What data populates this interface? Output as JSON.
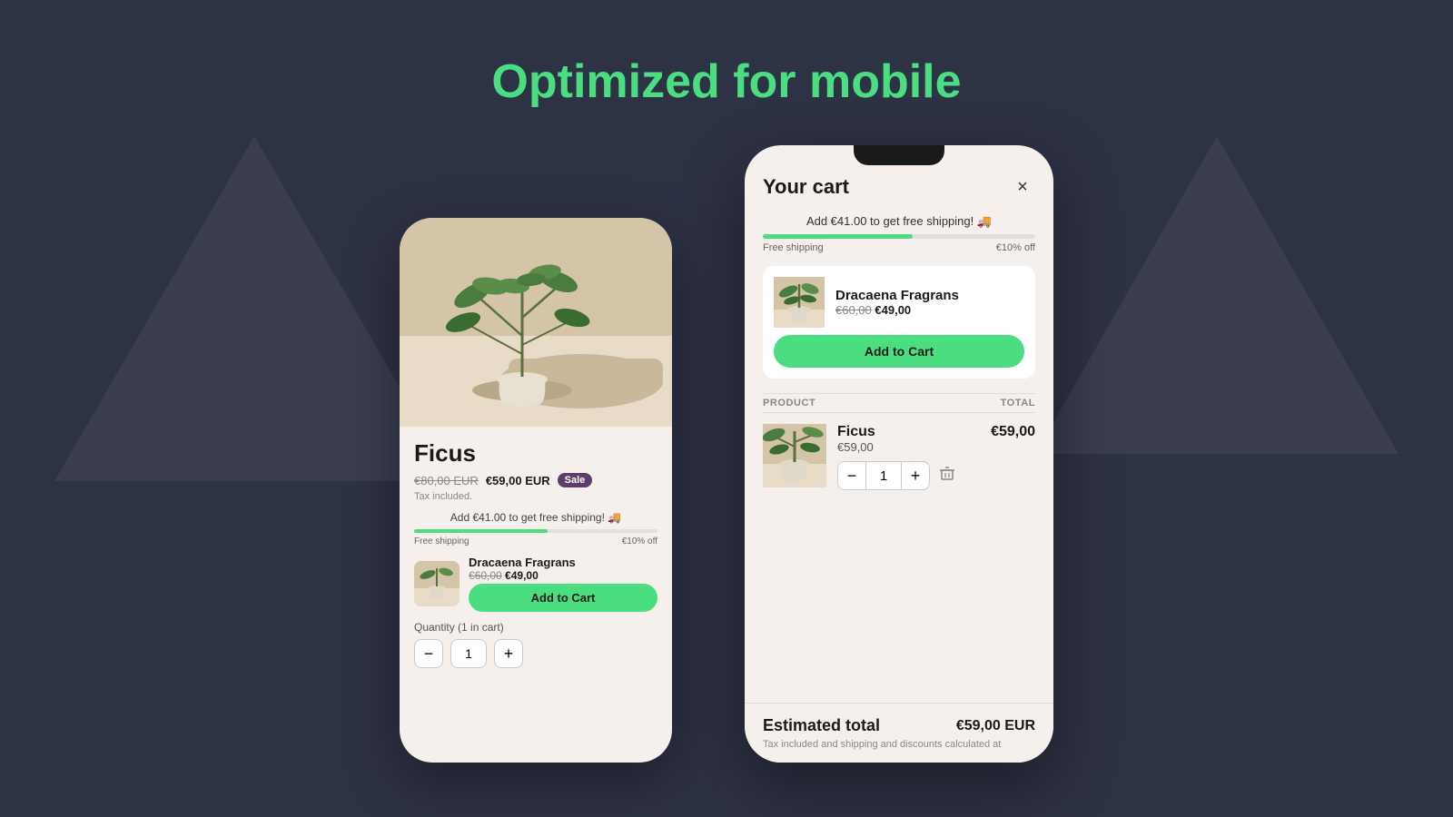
{
  "page": {
    "title": "Optimized for mobile",
    "bg_color": "#2e3245",
    "accent_color": "#4ade80"
  },
  "left_phone": {
    "product": {
      "name": "Ficus",
      "price_original": "€80,00 EUR",
      "price_sale": "€59,00 EUR",
      "sale_badge": "Sale",
      "tax_note": "Tax included.",
      "shipping_banner": "Add €41.00 to get free shipping! 🚚",
      "free_shipping_label": "Free shipping",
      "discount_label": "€10% off",
      "quantity_label": "Quantity (1 in cart)"
    },
    "upsell": {
      "name": "Dracaena Fragrans",
      "price_old": "€60,00",
      "price_new": "€49,00",
      "btn_label": "Add to Cart"
    },
    "quantity": {
      "value": "1",
      "decrement": "−",
      "increment": "+"
    }
  },
  "right_phone": {
    "cart": {
      "title": "Your cart",
      "close_icon": "×",
      "shipping_banner": "Add €41.00 to get free shipping! 🚚",
      "free_shipping_label": "Free shipping",
      "discount_label": "€10% off",
      "upsell": {
        "name": "Dracaena Fragrans",
        "price_old": "€60,00",
        "price_new": "€49,00",
        "btn_label": "Add to Cart"
      },
      "table_header": {
        "product_col": "PRODUCT",
        "total_col": "TOTAL"
      },
      "item": {
        "name": "Ficus",
        "price": "€59,00",
        "quantity": "1",
        "total": "€59,00",
        "qty_decrement": "−",
        "qty_increment": "+"
      },
      "footer": {
        "estimated_label": "Estimated total",
        "estimated_total": "€59,00 EUR",
        "tax_note": "Tax included and shipping and discounts calculated at"
      }
    }
  }
}
